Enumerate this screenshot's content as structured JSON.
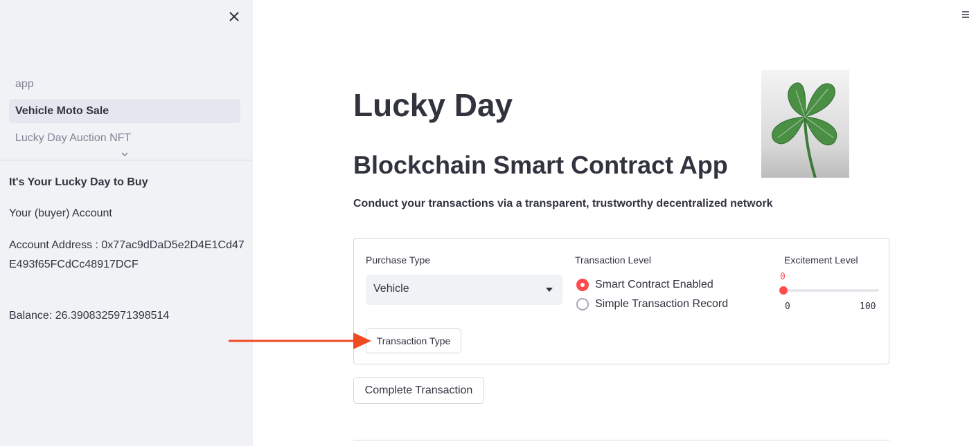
{
  "sidebar": {
    "nav_items": [
      {
        "label": "app"
      },
      {
        "label": "Vehicle Moto Sale"
      },
      {
        "label": "Lucky Day Auction NFT"
      }
    ],
    "heading": "It's Your Lucky Day to Buy",
    "account_label": "Your (buyer) Account",
    "address": "Account Address : 0x77ac9dDaD5e2D4E1Cd47E493f65FCdCc48917DCF",
    "balance": "Balance: 26.3908325971398514"
  },
  "header": {
    "menu_icon": "hamburger-icon"
  },
  "main": {
    "title": "Lucky Day",
    "subtitle": "Blockchain Smart Contract App",
    "tagline": "Conduct your transactions via a transparent, trustworthy decentralized network",
    "image_icon": "four-leaf-clover"
  },
  "form": {
    "purchase_type_label": "Purchase Type",
    "purchase_type_value": "Vehicle",
    "transaction_level_label": "Transaction Level",
    "transaction_levels": [
      {
        "label": "Smart Contract Enabled",
        "selected": true
      },
      {
        "label": "Simple Transaction Record",
        "selected": false
      }
    ],
    "excitement_label": "Excitement Level",
    "excitement_value": "0",
    "excitement_min": "0",
    "excitement_max": "100",
    "transaction_type_button": "Transaction Type"
  },
  "complete_button": "Complete Transaction",
  "colors": {
    "accent": "#ff4b4b",
    "sidebar_bg": "#f0f2f6",
    "arrow": "#f04a23"
  }
}
